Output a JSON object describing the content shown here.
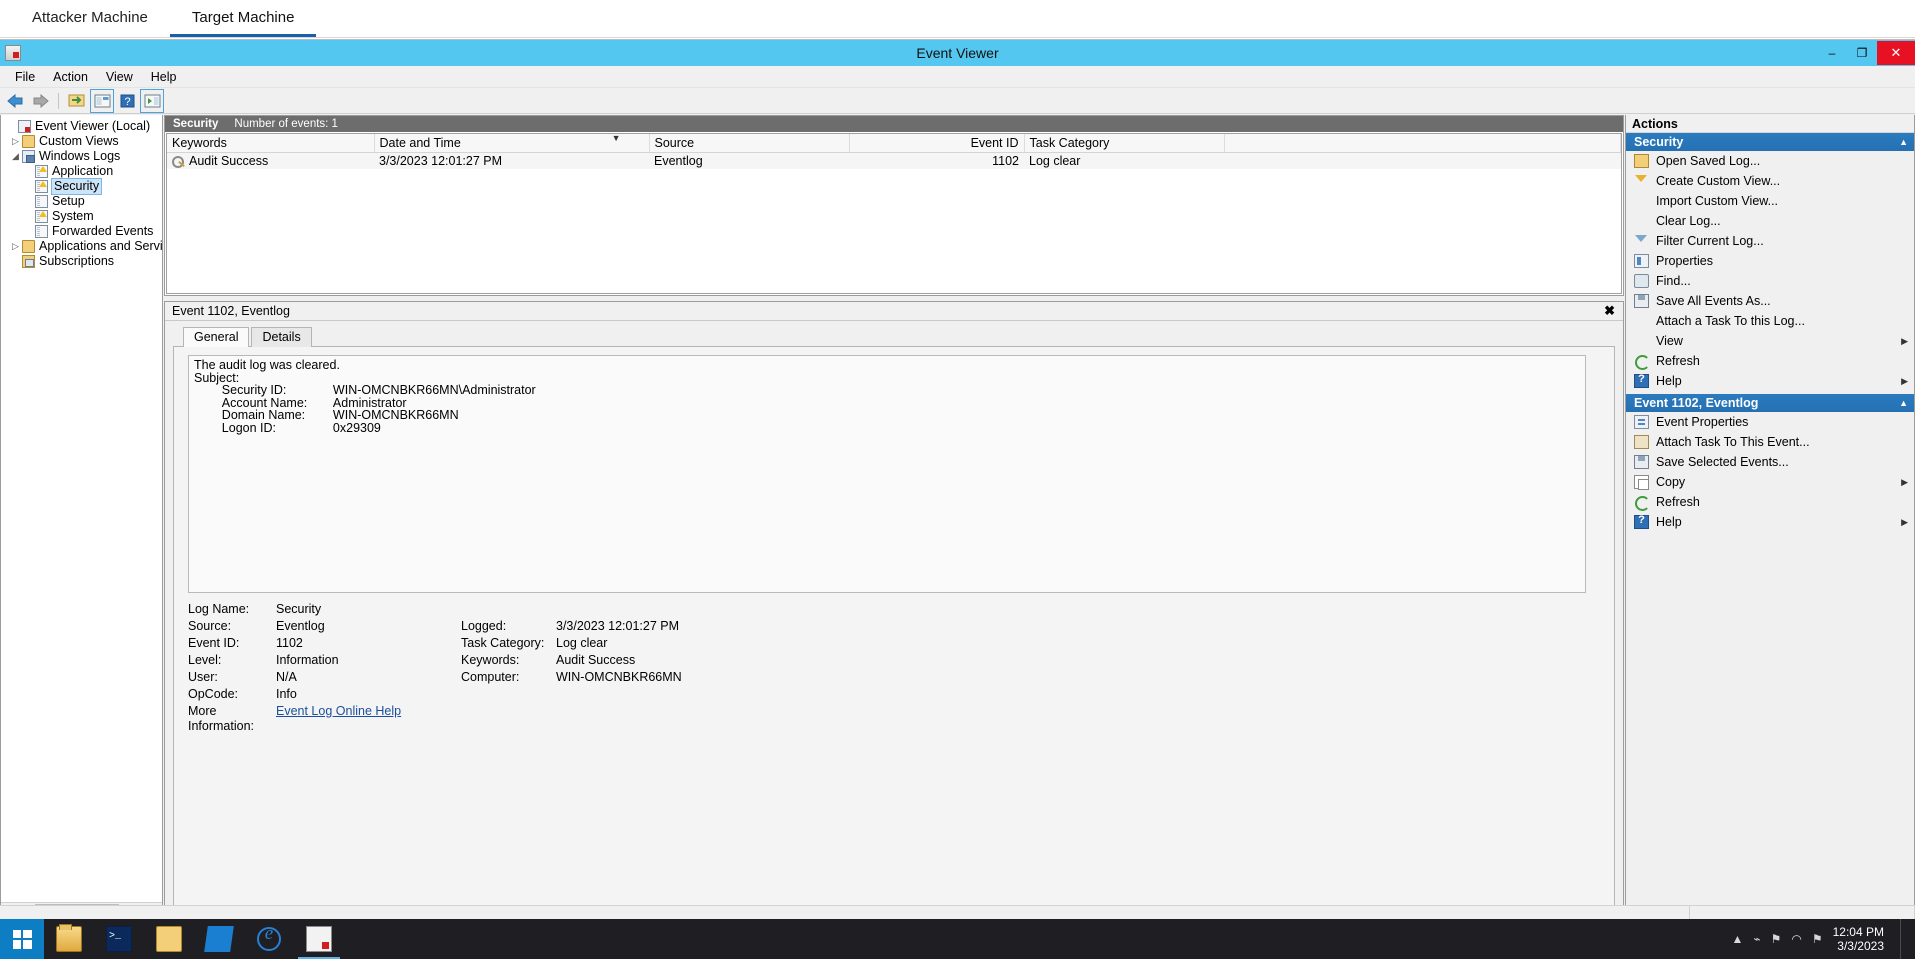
{
  "machine_tabs": [
    {
      "label": "Attacker Machine",
      "active": false
    },
    {
      "label": "Target Machine",
      "active": true
    }
  ],
  "window": {
    "title": "Event Viewer",
    "icon": "event-viewer-icon",
    "minimize": "–",
    "maximize": "❐",
    "close": "✕"
  },
  "menubar": [
    "File",
    "Action",
    "View",
    "Help"
  ],
  "toolbar": [
    {
      "name": "back-icon"
    },
    {
      "name": "forward-icon"
    },
    {
      "name": "show-hide-tree-icon"
    },
    {
      "name": "properties-icon"
    },
    {
      "name": "help-icon"
    },
    {
      "name": "show-hide-action-pane-icon"
    }
  ],
  "tree": [
    {
      "label": "Event Viewer (Local)",
      "indent": 0,
      "twist": "",
      "icon": "event-viewer-icon",
      "selected": false
    },
    {
      "label": "Custom Views",
      "indent": 1,
      "twist": "▷",
      "icon": "custom-views-folder-icon",
      "selected": false
    },
    {
      "label": "Windows Logs",
      "indent": 1,
      "twist": "◢",
      "icon": "windows-logs-icon",
      "selected": false
    },
    {
      "label": "Application",
      "indent": 3,
      "twist": "",
      "icon": "application-log-icon",
      "selected": false
    },
    {
      "label": "Security",
      "indent": 3,
      "twist": "",
      "icon": "security-log-icon",
      "selected": true
    },
    {
      "label": "Setup",
      "indent": 3,
      "twist": "",
      "icon": "setup-log-icon",
      "selected": false
    },
    {
      "label": "System",
      "indent": 3,
      "twist": "",
      "icon": "system-log-icon",
      "selected": false
    },
    {
      "label": "Forwarded Events",
      "indent": 3,
      "twist": "",
      "icon": "forwarded-events-icon",
      "selected": false
    },
    {
      "label": "Applications and Services Lo",
      "indent": 1,
      "twist": "▷",
      "icon": "app-services-logs-icon",
      "selected": false
    },
    {
      "label": "Subscriptions",
      "indent": 1,
      "twist": "",
      "icon": "subscriptions-icon",
      "selected": false
    }
  ],
  "tree_scroll": {
    "left_arrow": "◀",
    "right_arrow": "▶",
    "grip": "III"
  },
  "event_list": {
    "banner_name": "Security",
    "banner_count": "Number of events: 1",
    "columns": [
      {
        "key": "keywords",
        "label": "Keywords",
        "align": "left"
      },
      {
        "key": "datetime",
        "label": "Date and Time",
        "align": "left",
        "sorted": true,
        "sort_glyph": "▼"
      },
      {
        "key": "source",
        "label": "Source",
        "align": "left"
      },
      {
        "key": "eventid",
        "label": "Event ID",
        "align": "right"
      },
      {
        "key": "category",
        "label": "Task Category",
        "align": "left"
      },
      {
        "key": "spacer",
        "label": "",
        "align": "left"
      }
    ],
    "rows": [
      {
        "keywords": "Audit Success",
        "keywords_icon": "audit-success-key-icon",
        "datetime": "3/3/2023 12:01:27 PM",
        "source": "Eventlog",
        "eventid": "1102",
        "category": "Log clear",
        "spacer": ""
      }
    ]
  },
  "detail": {
    "header": "Event 1102, Eventlog",
    "close_glyph": "✖",
    "tabs": [
      {
        "label": "General",
        "active": true
      },
      {
        "label": "Details",
        "active": false
      }
    ],
    "message": "The audit log was cleared.\nSubject:\n\tSecurity ID:\t\tWIN-OMCNBKR66MN\\Administrator\n\tAccount Name:\tAdministrator\n\tDomain Name:\tWIN-OMCNBKR66MN\n\tLogon ID:\t\t0x29309",
    "fields": [
      {
        "label": "Log Name:",
        "value": "Security",
        "label2": "",
        "value2": ""
      },
      {
        "label": "Source:",
        "value": "Eventlog",
        "label2": "Logged:",
        "value2": "3/3/2023 12:01:27 PM"
      },
      {
        "label": "Event ID:",
        "value": "1102",
        "label2": "Task Category:",
        "value2": "Log clear"
      },
      {
        "label": "Level:",
        "value": "Information",
        "label2": "Keywords:",
        "value2": "Audit Success"
      },
      {
        "label": "User:",
        "value": "N/A",
        "label2": "Computer:",
        "value2": "WIN-OMCNBKR66MN"
      },
      {
        "label": "OpCode:",
        "value": "Info",
        "label2": "",
        "value2": ""
      },
      {
        "label": "More Information:",
        "value": "Event Log Online Help",
        "value_is_link": true,
        "label2": "",
        "value2": ""
      }
    ]
  },
  "actions": {
    "title": "Actions",
    "groups": [
      {
        "header": "Security",
        "collapse_glyph": "▲",
        "items": [
          {
            "label": "Open Saved Log...",
            "icon": "open-saved-log-icon",
            "submenu": false
          },
          {
            "label": "Create Custom View...",
            "icon": "create-custom-view-icon",
            "submenu": false
          },
          {
            "label": "Import Custom View...",
            "icon": "",
            "submenu": false
          },
          {
            "label": "Clear Log...",
            "icon": "",
            "submenu": false
          },
          {
            "label": "Filter Current Log...",
            "icon": "filter-icon",
            "submenu": false
          },
          {
            "label": "Properties",
            "icon": "properties-icon",
            "submenu": false
          },
          {
            "label": "Find...",
            "icon": "find-icon",
            "submenu": false
          },
          {
            "label": "Save All Events As...",
            "icon": "save-icon",
            "submenu": false
          },
          {
            "label": "Attach a Task To this Log...",
            "icon": "",
            "submenu": false
          },
          {
            "label": "View",
            "icon": "",
            "submenu": true
          },
          {
            "label": "Refresh",
            "icon": "refresh-icon",
            "submenu": false
          },
          {
            "label": "Help",
            "icon": "help-icon",
            "submenu": true
          }
        ]
      },
      {
        "header": "Event 1102, Eventlog",
        "collapse_glyph": "▲",
        "items": [
          {
            "label": "Event Properties",
            "icon": "event-properties-icon",
            "submenu": false
          },
          {
            "label": "Attach Task To This Event...",
            "icon": "attach-task-icon",
            "submenu": false
          },
          {
            "label": "Save Selected Events...",
            "icon": "save-icon",
            "submenu": false
          },
          {
            "label": "Copy",
            "icon": "copy-icon",
            "submenu": true
          },
          {
            "label": "Refresh",
            "icon": "refresh-icon",
            "submenu": false
          },
          {
            "label": "Help",
            "icon": "help-icon",
            "submenu": true
          }
        ]
      }
    ],
    "submenu_glyph": "▶"
  },
  "taskbar": {
    "start": "start-button",
    "apps": [
      {
        "name": "taskbar-item-file-explorer-pinned",
        "glyph": "g-explorer",
        "active": false
      },
      {
        "name": "taskbar-item-powershell",
        "glyph": "g-ps",
        "active": false
      },
      {
        "name": "taskbar-item-file-explorer",
        "glyph": "g-folder2",
        "active": false
      },
      {
        "name": "taskbar-item-server-manager",
        "glyph": "g-blue",
        "active": false
      },
      {
        "name": "taskbar-item-internet-explorer",
        "glyph": "g-ie",
        "active": false
      },
      {
        "name": "taskbar-item-event-viewer",
        "glyph": "g-ev",
        "active": true
      }
    ],
    "tray": [
      {
        "name": "show-hidden-icons-chevron",
        "glyph": "▲"
      },
      {
        "name": "network-icon",
        "glyph": "⌁"
      },
      {
        "name": "flag-icon",
        "glyph": "⚑"
      },
      {
        "name": "volume-icon",
        "glyph": "◠"
      },
      {
        "name": "action-center-icon",
        "glyph": "⚑"
      }
    ],
    "clock_time": "12:04 PM",
    "clock_date": "3/3/2023"
  },
  "colors": {
    "titlebar": "#54c7f0",
    "accent_tab": "#1b5fa8",
    "action_group_header": "#2b7bbf",
    "banner": "#6d6d6d",
    "close_button": "#e81123"
  }
}
